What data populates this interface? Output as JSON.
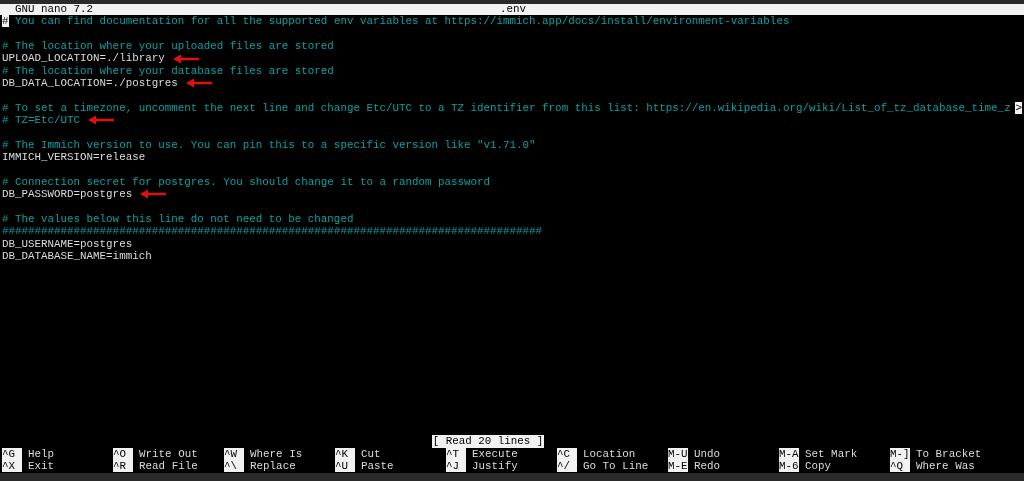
{
  "title_bar": {
    "app": "GNU nano 7.2",
    "file": ".env"
  },
  "lines": [
    {
      "kind": "comment",
      "text": "# You can find documentation for all the supported env variables at https://immich.app/docs/install/environment-variables",
      "cursor": true
    },
    {
      "kind": "blank"
    },
    {
      "kind": "comment",
      "text": "# The location where your uploaded files are stored"
    },
    {
      "kind": "setting",
      "text": "UPLOAD_LOCATION=./library",
      "arrow": true
    },
    {
      "kind": "comment",
      "text": "# The location where your database files are stored"
    },
    {
      "kind": "setting",
      "text": "DB_DATA_LOCATION=./postgres",
      "arrow": true
    },
    {
      "kind": "blank"
    },
    {
      "kind": "comment",
      "text": "# To set a timezone, uncomment the next line and change Etc/UTC to a TZ identifier from this list: https://en.wikipedia.org/wiki/List_of_tz_database_time_z",
      "overflow_marker": ">"
    },
    {
      "kind": "comment",
      "text": "# TZ=Etc/UTC",
      "arrow": true
    },
    {
      "kind": "blank"
    },
    {
      "kind": "comment",
      "text": "# The Immich version to use. You can pin this to a specific version like \"v1.71.0\""
    },
    {
      "kind": "setting",
      "text": "IMMICH_VERSION=release"
    },
    {
      "kind": "blank"
    },
    {
      "kind": "comment",
      "text": "# Connection secret for postgres. You should change it to a random password"
    },
    {
      "kind": "setting",
      "text": "DB_PASSWORD=postgres",
      "arrow": true
    },
    {
      "kind": "blank"
    },
    {
      "kind": "comment",
      "text": "# The values below this line do not need to be changed"
    },
    {
      "kind": "comment",
      "text": "###################################################################################"
    },
    {
      "kind": "setting",
      "text": "DB_USERNAME=postgres"
    },
    {
      "kind": "setting",
      "text": "DB_DATABASE_NAME=immich"
    }
  ],
  "status": "[ Read 20 lines ]",
  "shortcuts": [
    [
      {
        "key": "^G",
        "label": "Help"
      },
      {
        "key": "^O",
        "label": "Write Out"
      },
      {
        "key": "^W",
        "label": "Where Is"
      },
      {
        "key": "^K",
        "label": "Cut"
      },
      {
        "key": "^T",
        "label": "Execute"
      },
      {
        "key": "^C",
        "label": "Location"
      },
      {
        "key": "M-U",
        "label": "Undo"
      },
      {
        "key": "M-A",
        "label": "Set Mark"
      },
      {
        "key": "M-]",
        "label": "To Bracket"
      }
    ],
    [
      {
        "key": "^X",
        "label": "Exit"
      },
      {
        "key": "^R",
        "label": "Read File"
      },
      {
        "key": "^\\",
        "label": "Replace"
      },
      {
        "key": "^U",
        "label": "Paste"
      },
      {
        "key": "^J",
        "label": "Justify"
      },
      {
        "key": "^/",
        "label": "Go To Line"
      },
      {
        "key": "M-E",
        "label": "Redo"
      },
      {
        "key": "M-6",
        "label": "Copy"
      },
      {
        "key": "^Q",
        "label": "Where Was"
      }
    ]
  ]
}
